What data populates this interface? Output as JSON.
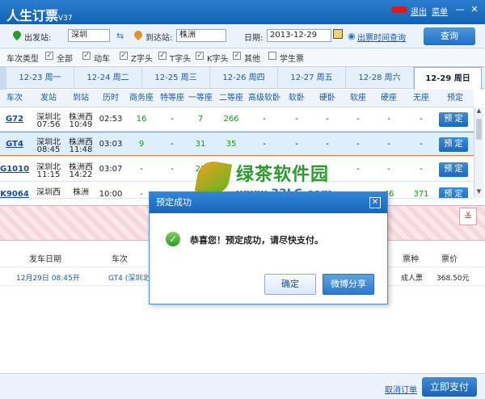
{
  "window": {
    "title": "人生订票",
    "version": "V37",
    "logout": "退出",
    "menu": "菜单",
    "minimize": "—",
    "close": "✕"
  },
  "search": {
    "from_label": "出发站:",
    "from_value": "深圳",
    "swap": "⇆",
    "to_label": "到达站:",
    "to_value": "株洲",
    "date_label": "日期:",
    "date_value": "2013-12-29",
    "schedule_link": "出票时间查询",
    "search_button": "查询"
  },
  "train_types": {
    "label": "车次类型",
    "options": [
      {
        "label": "全部",
        "checked": true
      },
      {
        "label": "动车",
        "checked": true
      },
      {
        "label": "Z字头",
        "checked": true
      },
      {
        "label": "T字头",
        "checked": true
      },
      {
        "label": "K字头",
        "checked": true
      },
      {
        "label": "其他",
        "checked": true
      },
      {
        "label": "学生票",
        "checked": false
      }
    ]
  },
  "date_tabs": [
    {
      "label": "12-23 周一"
    },
    {
      "label": "12-24 周二"
    },
    {
      "label": "12-25 周三"
    },
    {
      "label": "12-26 周四"
    },
    {
      "label": "12-27 周五"
    },
    {
      "label": "12-28 周六"
    },
    {
      "label": "12-29 周日",
      "active": true
    }
  ],
  "table": {
    "headers": [
      "车次",
      "发站",
      "到站",
      "历时",
      "商务座",
      "特等座",
      "一等座",
      "二等座",
      "高级软卧",
      "软卧",
      "硬卧",
      "软座",
      "硬座",
      "无座",
      "预定"
    ],
    "rows": [
      {
        "train": "G72",
        "from": "深圳北",
        "dep": "07:56",
        "to": "株洲西",
        "arr": "10:49",
        "duration": "02:53",
        "business": "16",
        "special": "-",
        "first": "7",
        "second": "266",
        "hsoft": "-",
        "soft": "-",
        "hard": "-",
        "softseat": "-",
        "hardseat": "-",
        "noseat": "-",
        "book": "预 定"
      },
      {
        "train": "GT4",
        "from": "深圳北",
        "dep": "08:45",
        "to": "株洲西",
        "arr": "11:48",
        "duration": "03:03",
        "business": "9",
        "special": "-",
        "first": "31",
        "second": "35",
        "hsoft": "-",
        "soft": "-",
        "hard": "-",
        "softseat": "-",
        "hardseat": "-",
        "noseat": "-",
        "book": "预 定",
        "selected": true
      },
      {
        "train": "G1010",
        "from": "深圳北",
        "dep": "11:15",
        "to": "株洲西",
        "arr": "14:22",
        "duration": "03:07",
        "business": "-",
        "special": "-",
        "first": "21",
        "second": "",
        "hsoft": "-",
        "soft": "-",
        "hard": "-",
        "softseat": "-",
        "hardseat": "-",
        "noseat": "-",
        "book": "预 定"
      },
      {
        "train": "K9064",
        "from": "深圳西",
        "dep": "",
        "to": "株洲",
        "arr": "",
        "duration": "10:00",
        "business": "-",
        "special": "-",
        "first": "-",
        "second": "-",
        "hsoft": "-",
        "soft": "-",
        "hard": "",
        "softseat": "-",
        "hardseat": "46",
        "noseat": "371",
        "book": "预 定"
      }
    ]
  },
  "collapse_icon": "double-chevron-down-icon",
  "collapse_glyph": "≚",
  "order": {
    "headers": {
      "date": "发车日期",
      "train": "车次",
      "ticket_type": "票种",
      "price": "票价"
    },
    "row": {
      "date": "12月29日 08:45开",
      "train": "GT4 (深圳北-株洲西",
      "ticket_type": "成人票",
      "price": "368.50元"
    }
  },
  "watermark": {
    "text": "绿茶软件园",
    "url": "www.33LC.com"
  },
  "dialog": {
    "title": "预定成功",
    "close": "✕",
    "message": "恭喜您！预定成功，请尽快支付。",
    "ok_glyph": "✓",
    "confirm": "确定",
    "share": "微博分享"
  },
  "footer": {
    "cancel_order": "取消订单",
    "pay_now": "立即支付"
  }
}
